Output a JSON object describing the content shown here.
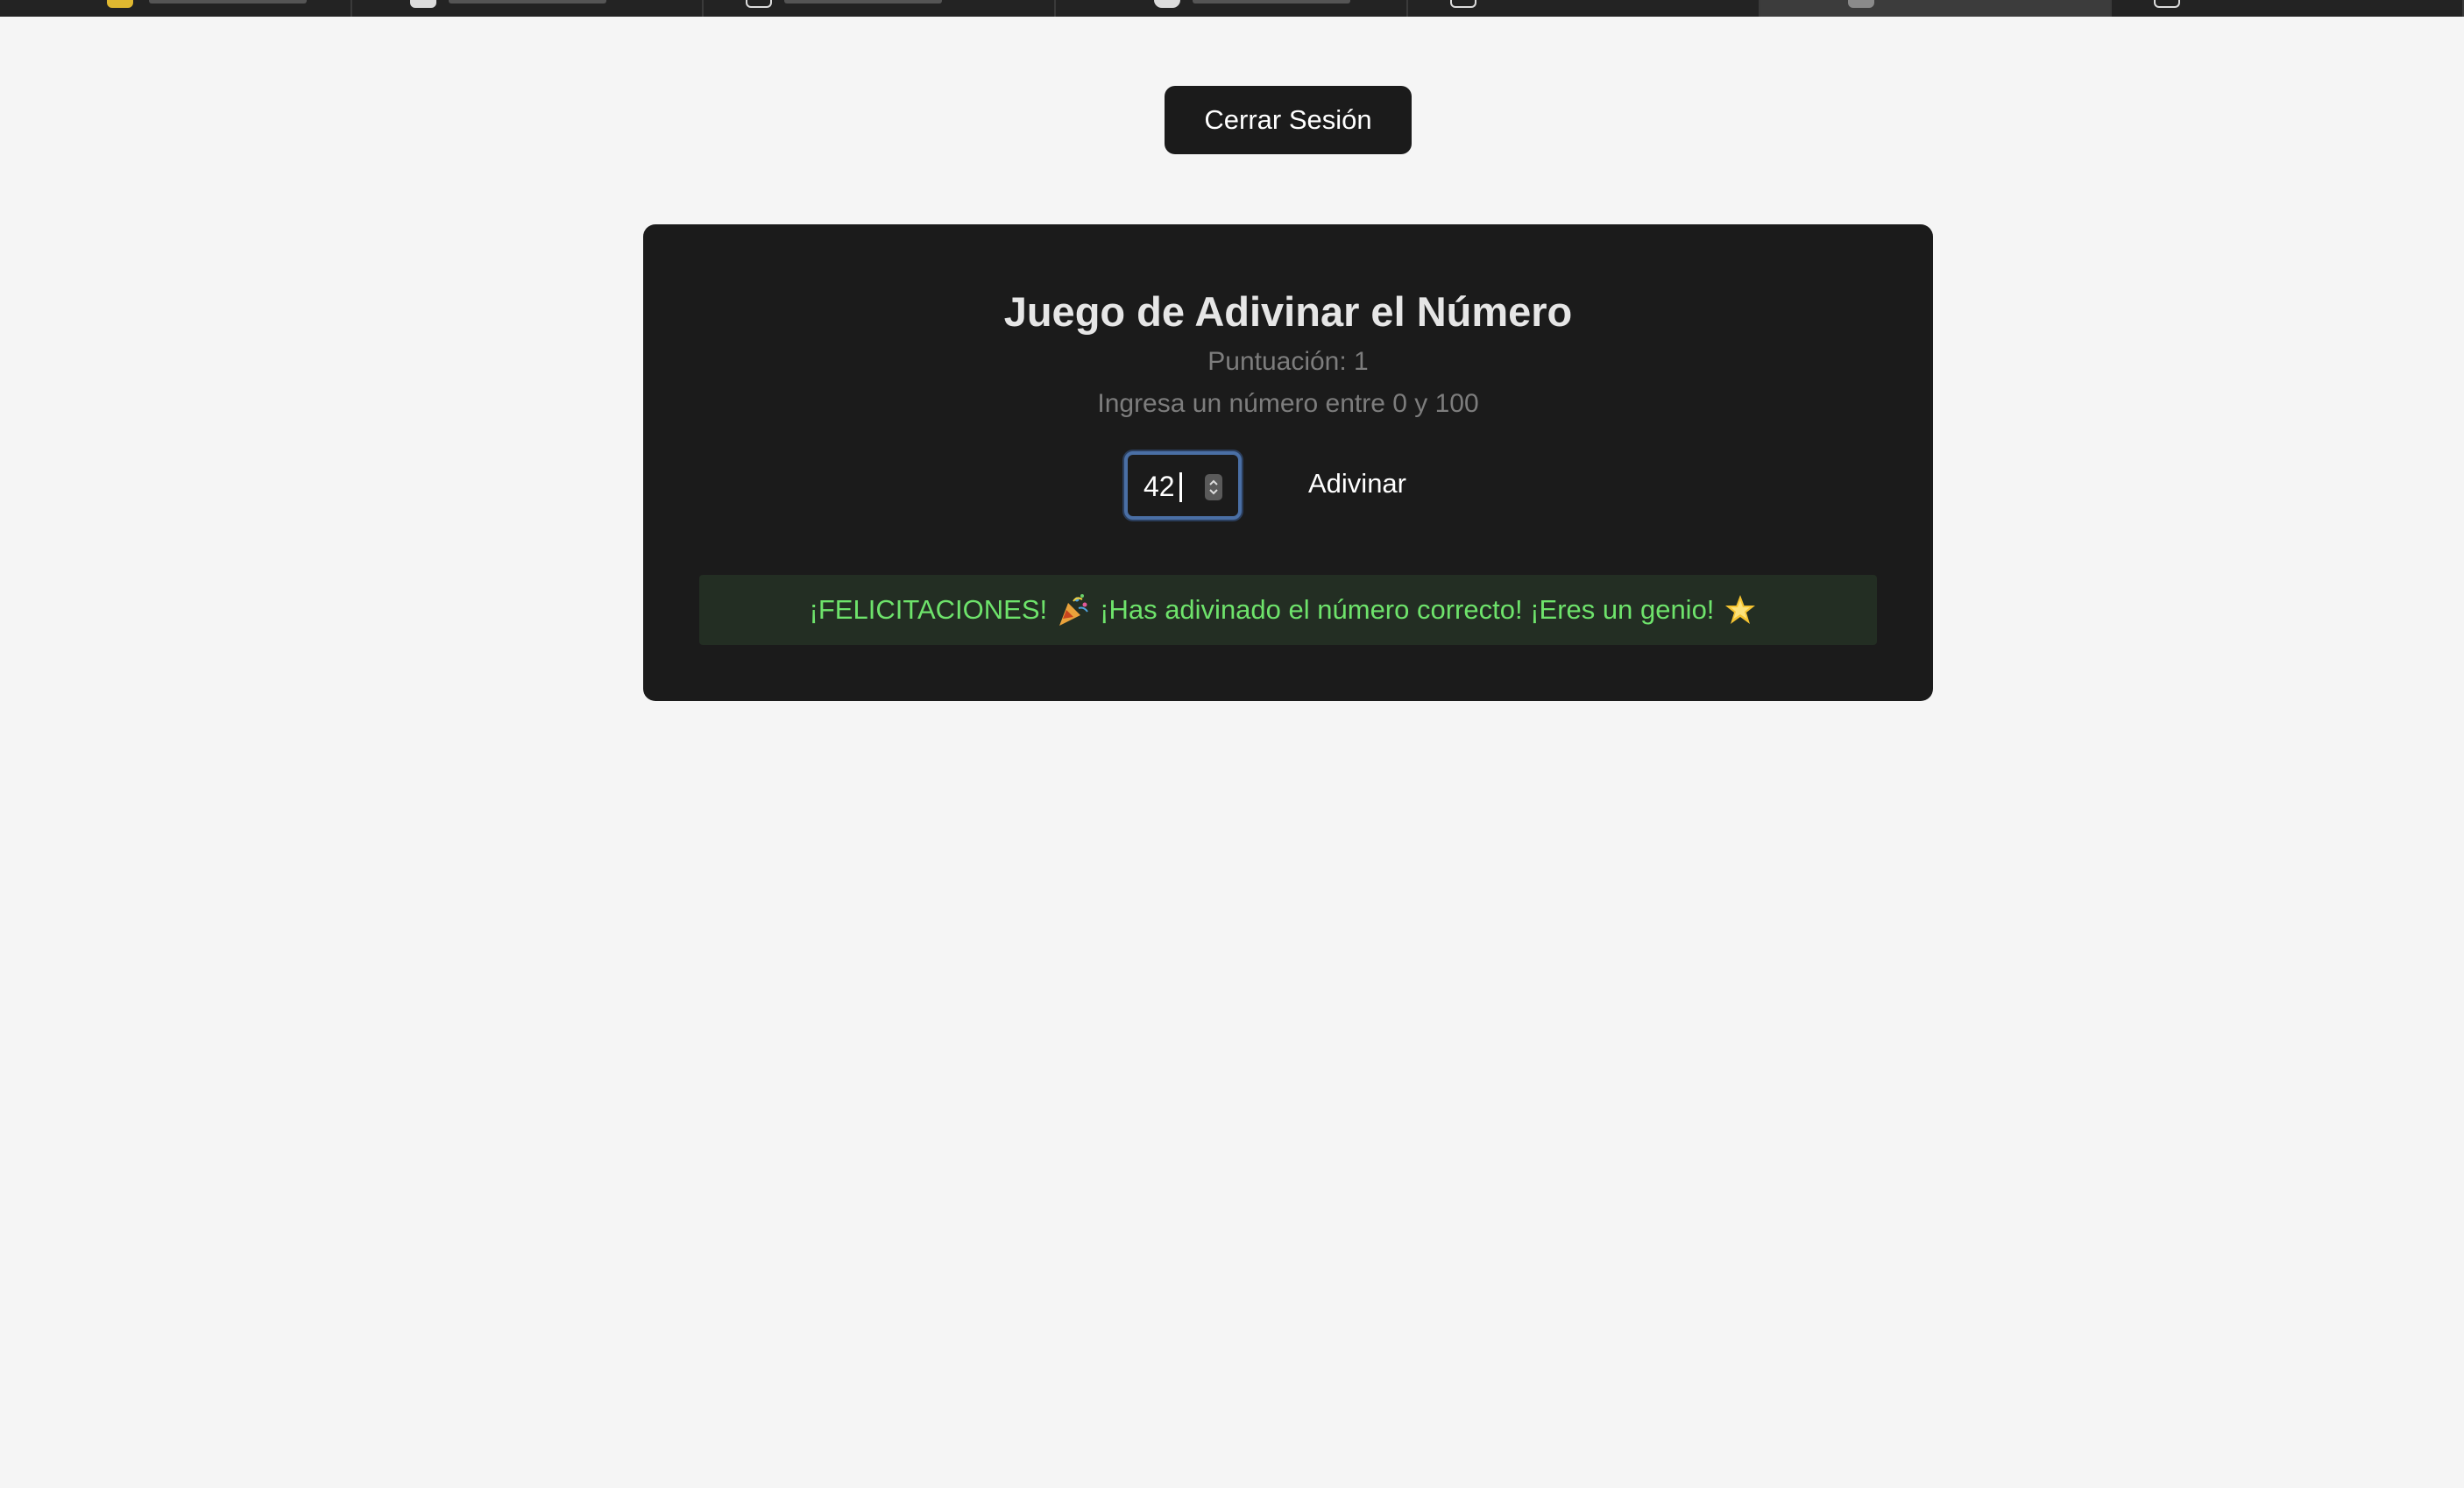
{
  "browser": {
    "tab_count": 7,
    "active_tab_index": 5
  },
  "header": {
    "logout_label": "Cerrar Sesión"
  },
  "game": {
    "title": "Juego de Adivinar el Número",
    "score_label": "Puntuación: 1",
    "instructions": "Ingresa un número entre 0 y 100",
    "input_value": "42",
    "guess_label": "Adivinar",
    "result": {
      "part1": "¡FELICITACIONES!",
      "party_icon": "party-popper-icon",
      "part2": "¡Has adivinado el número correcto! ¡Eres un genio!",
      "star_icon": "glowing-star-icon",
      "color": "#6ee36b"
    }
  },
  "colors": {
    "page_bg": "#f5f5f5",
    "card_bg": "#1b1b1b",
    "focus_ring": "#4a6fa5",
    "success_text": "#6ee36b",
    "success_bg": "#232e23"
  }
}
